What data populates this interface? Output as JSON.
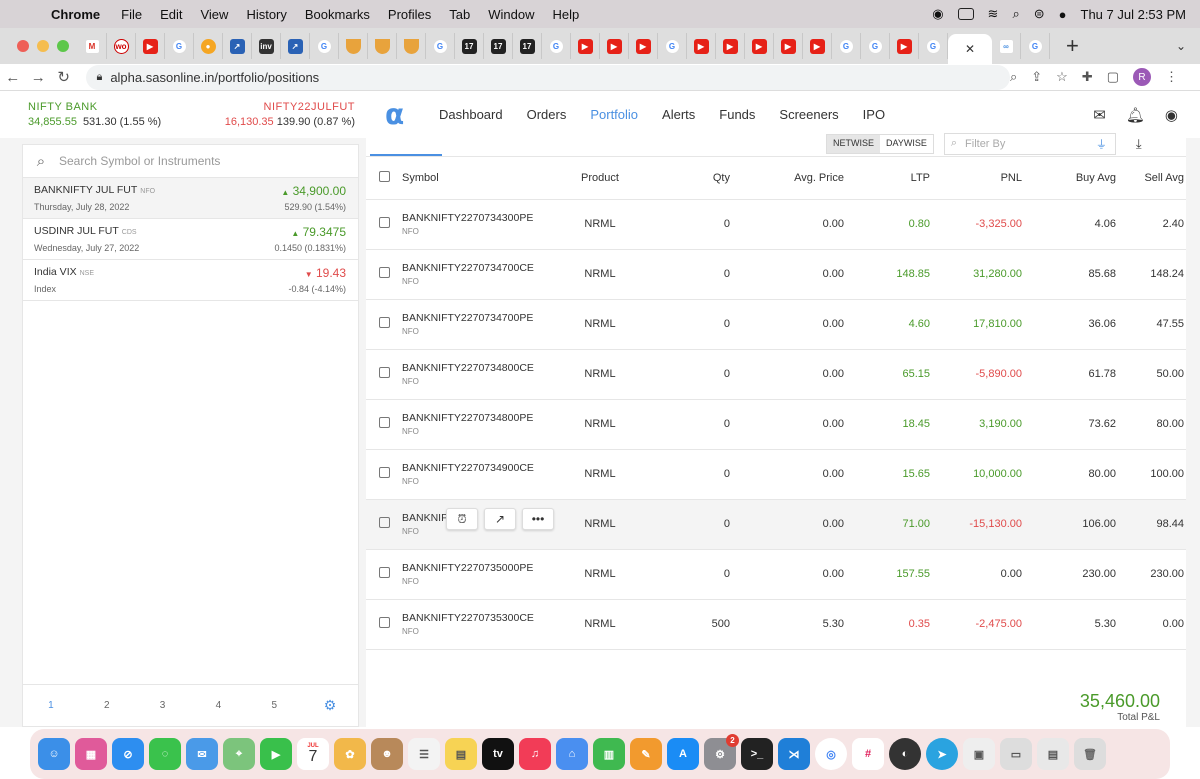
{
  "macmenu": {
    "app": "Chrome",
    "items": [
      "File",
      "Edit",
      "View",
      "History",
      "Bookmarks",
      "Profiles",
      "Tab",
      "Window",
      "Help"
    ],
    "clock": "Thu 7 Jul  2:53 PM"
  },
  "browser": {
    "url": "alpha.sasonline.in/portfolio/positions",
    "profile_initial": "R"
  },
  "tickers": [
    {
      "name": "NIFTY BANK",
      "ltp": "34,855.55",
      "change": "531.30 (1.55 %)"
    },
    {
      "name": "NIFTY22JULFUT",
      "ltp": "16,130.35",
      "change": "139.90 (0.87 %)"
    }
  ],
  "nav": {
    "links": [
      "Dashboard",
      "Orders",
      "Portfolio",
      "Alerts",
      "Funds",
      "Screeners",
      "IPO"
    ]
  },
  "watchlist": {
    "search_placeholder": "Search Symbol or Instruments",
    "items": [
      {
        "symbol": "BANKNIFTY JUL FUT",
        "exch": "NFO",
        "ltp": "34,900.00",
        "date": "Thursday, July 28, 2022",
        "change": "529.90 (1.54%)",
        "dir": "up"
      },
      {
        "symbol": "USDINR JUL FUT",
        "exch": "CDS",
        "ltp": "79.3475",
        "date": "Wednesday, July 27, 2022",
        "change": "0.1450 (0.1831%)",
        "dir": "up"
      },
      {
        "symbol": "India VIX",
        "exch": "NSE",
        "ltp": "19.43",
        "date": "Index",
        "change": "-0.84 (-4.14%)",
        "dir": "down"
      }
    ],
    "pages": [
      "1",
      "2",
      "3",
      "4",
      "5"
    ]
  },
  "positions": {
    "toggle": [
      "NETWISE",
      "DAYWISE"
    ],
    "filter_placeholder": "Filter By",
    "headers": [
      "Symbol",
      "Product",
      "Qty",
      "Avg. Price",
      "LTP",
      "PNL",
      "Buy Avg",
      "Sell Avg"
    ],
    "rows": [
      {
        "symbol": "BANKNIFTY2270734300PE",
        "exch": "NFO",
        "product": "NRML",
        "qty": "0",
        "avg": "0.00",
        "ltp": "0.80",
        "ltp_dir": "up",
        "pnl": "-3,325.00",
        "pnl_dir": "down",
        "buy": "4.06",
        "sell": "2.40"
      },
      {
        "symbol": "BANKNIFTY2270734700CE",
        "exch": "NFO",
        "product": "NRML",
        "qty": "0",
        "avg": "0.00",
        "ltp": "148.85",
        "ltp_dir": "up",
        "pnl": "31,280.00",
        "pnl_dir": "up",
        "buy": "85.68",
        "sell": "148.24"
      },
      {
        "symbol": "BANKNIFTY2270734700PE",
        "exch": "NFO",
        "product": "NRML",
        "qty": "0",
        "avg": "0.00",
        "ltp": "4.60",
        "ltp_dir": "up",
        "pnl": "17,810.00",
        "pnl_dir": "up",
        "buy": "36.06",
        "sell": "47.55"
      },
      {
        "symbol": "BANKNIFTY2270734800CE",
        "exch": "NFO",
        "product": "NRML",
        "qty": "0",
        "avg": "0.00",
        "ltp": "65.15",
        "ltp_dir": "up",
        "pnl": "-5,890.00",
        "pnl_dir": "down",
        "buy": "61.78",
        "sell": "50.00"
      },
      {
        "symbol": "BANKNIFTY2270734800PE",
        "exch": "NFO",
        "product": "NRML",
        "qty": "0",
        "avg": "0.00",
        "ltp": "18.45",
        "ltp_dir": "up",
        "pnl": "3,190.00",
        "pnl_dir": "up",
        "buy": "73.62",
        "sell": "80.00"
      },
      {
        "symbol": "BANKNIFTY2270734900CE",
        "exch": "NFO",
        "product": "NRML",
        "qty": "0",
        "avg": "0.00",
        "ltp": "15.65",
        "ltp_dir": "up",
        "pnl": "10,000.00",
        "pnl_dir": "up",
        "buy": "80.00",
        "sell": "100.00"
      },
      {
        "symbol": "BANKNIF",
        "exch": "NFO",
        "product": "NRML",
        "qty": "0",
        "avg": "0.00",
        "ltp": "71.00",
        "ltp_dir": "up",
        "pnl": "-15,130.00",
        "pnl_dir": "down",
        "buy": "106.00",
        "sell": "98.44"
      },
      {
        "symbol": "BANKNIFTY2270735000PE",
        "exch": "NFO",
        "product": "NRML",
        "qty": "0",
        "avg": "0.00",
        "ltp": "157.55",
        "ltp_dir": "up",
        "pnl": "0.00",
        "pnl_dir": "flat",
        "buy": "230.00",
        "sell": "230.00"
      },
      {
        "symbol": "BANKNIFTY2270735300CE",
        "exch": "NFO",
        "product": "NRML",
        "qty": "500",
        "avg": "5.30",
        "ltp": "0.35",
        "ltp_dir": "down",
        "pnl": "-2,475.00",
        "pnl_dir": "down",
        "buy": "5.30",
        "sell": "0.00"
      }
    ],
    "total_value": "35,460.00",
    "total_label": "Total P&L"
  },
  "dock": {
    "calendar_month": "JUL",
    "calendar_day": "7",
    "badge_count": "2"
  },
  "colors": {
    "accent": "#4a90e2",
    "positive": "#4a9a2a",
    "negative": "#e04b4b"
  }
}
